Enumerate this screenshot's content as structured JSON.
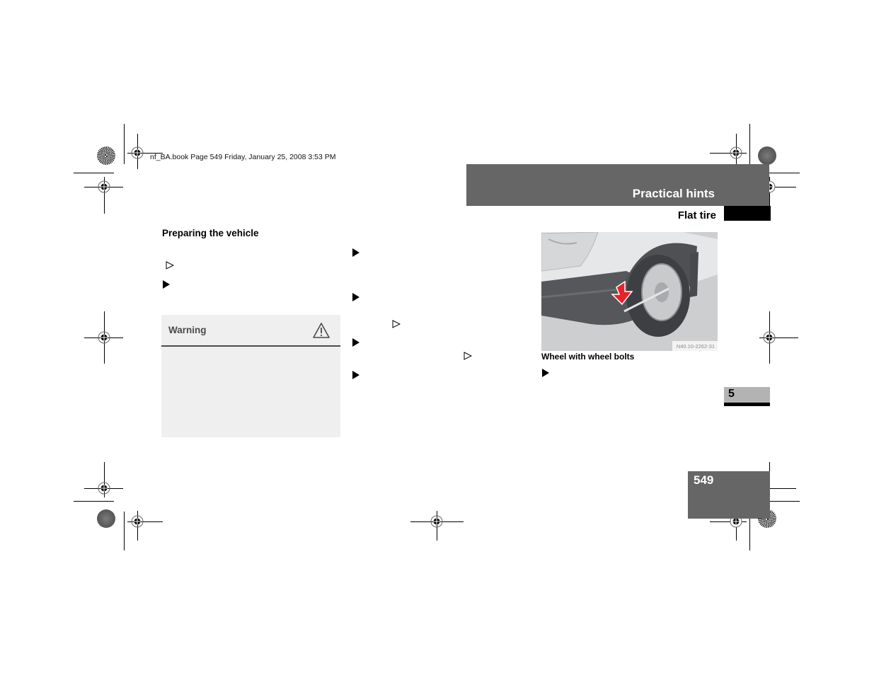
{
  "print_info": {
    "book_line": "nf_BA.book  Page 549  Friday, January 25, 2008  3:53 PM"
  },
  "header": {
    "section": "Practical hints",
    "subsection": "Flat tire"
  },
  "left_column": {
    "title": "Preparing the vehicle",
    "markers": [
      "outline-triangle",
      "bullet"
    ],
    "warning": {
      "label": "Warning",
      "icon": "warning-triangle-icon"
    }
  },
  "middle_column": {
    "markers": [
      "bullet",
      "bullet",
      "outline-triangle",
      "bullet",
      "outline-triangle",
      "bullet"
    ]
  },
  "right_column": {
    "figure": {
      "code": "N40.10-2262-31",
      "description": "Front wheel of van with red arrow pointing at wheel bolt"
    },
    "caption": "Wheel with wheel bolts",
    "markers": [
      "bullet"
    ]
  },
  "chapter_tab": {
    "number": "5"
  },
  "page": {
    "number": "549"
  },
  "colors": {
    "header_band": "#666666",
    "chapter_tab": "#b3b3b3",
    "warning_bg": "#efefef",
    "warning_rule": "#4a4a4a",
    "figure_arrow": "#e8222a"
  }
}
